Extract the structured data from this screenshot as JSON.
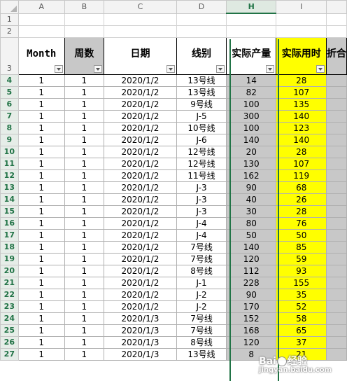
{
  "columns": [
    "A",
    "B",
    "C",
    "D",
    "H",
    "I",
    ""
  ],
  "selected_column": "H",
  "row_labels": [
    "1",
    "2",
    "3",
    "4",
    "5",
    "6",
    "7",
    "8",
    "9",
    "10",
    "11",
    "12",
    "13",
    "14",
    "15",
    "16",
    "17",
    "18",
    "19",
    "20",
    "21",
    "22",
    "23",
    "24",
    "25",
    "26",
    "27"
  ],
  "headers": {
    "month": "Month",
    "week": "周数",
    "date": "日期",
    "line": "线别",
    "output": "实际产量",
    "hours": "实际用时",
    "partial": "折合"
  },
  "rows": [
    [
      "1",
      "1",
      "2020/1/2",
      "13号线",
      "14",
      "28"
    ],
    [
      "1",
      "1",
      "2020/1/2",
      "13号线",
      "82",
      "107"
    ],
    [
      "1",
      "1",
      "2020/1/2",
      "9号线",
      "100",
      "135"
    ],
    [
      "1",
      "1",
      "2020/1/2",
      "J-5",
      "300",
      "140"
    ],
    [
      "1",
      "1",
      "2020/1/2",
      "10号线",
      "100",
      "123"
    ],
    [
      "1",
      "1",
      "2020/1/2",
      "J-6",
      "140",
      "140"
    ],
    [
      "1",
      "1",
      "2020/1/2",
      "12号线",
      "20",
      "28"
    ],
    [
      "1",
      "1",
      "2020/1/2",
      "12号线",
      "130",
      "107"
    ],
    [
      "1",
      "1",
      "2020/1/2",
      "11号线",
      "162",
      "119"
    ],
    [
      "1",
      "1",
      "2020/1/2",
      "J-3",
      "90",
      "68"
    ],
    [
      "1",
      "1",
      "2020/1/2",
      "J-3",
      "40",
      "26"
    ],
    [
      "1",
      "1",
      "2020/1/2",
      "J-3",
      "30",
      "28"
    ],
    [
      "1",
      "1",
      "2020/1/2",
      "J-4",
      "80",
      "76"
    ],
    [
      "1",
      "1",
      "2020/1/2",
      "J-4",
      "50",
      "50"
    ],
    [
      "1",
      "1",
      "2020/1/2",
      "7号线",
      "140",
      "85"
    ],
    [
      "1",
      "1",
      "2020/1/2",
      "7号线",
      "120",
      "59"
    ],
    [
      "1",
      "1",
      "2020/1/2",
      "8号线",
      "112",
      "93"
    ],
    [
      "1",
      "1",
      "2020/1/2",
      "J-1",
      "228",
      "155"
    ],
    [
      "1",
      "1",
      "2020/1/2",
      "J-2",
      "90",
      "35"
    ],
    [
      "1",
      "1",
      "2020/1/2",
      "J-2",
      "170",
      "52"
    ],
    [
      "1",
      "1",
      "2020/1/3",
      "7号线",
      "152",
      "58"
    ],
    [
      "1",
      "1",
      "2020/1/3",
      "7号线",
      "168",
      "65"
    ],
    [
      "1",
      "1",
      "2020/1/3",
      "8号线",
      "120",
      "37"
    ],
    [
      "1",
      "1",
      "2020/1/3",
      "13号线",
      "8",
      "21"
    ]
  ],
  "watermark": {
    "brand": "Bai",
    "brand_end": "经验",
    "sub": "jingyan.baidu.com"
  },
  "colors": {
    "gray_fill": "#c8c8c8",
    "yellow_fill": "#ffff00",
    "selection_green": "#217346"
  }
}
